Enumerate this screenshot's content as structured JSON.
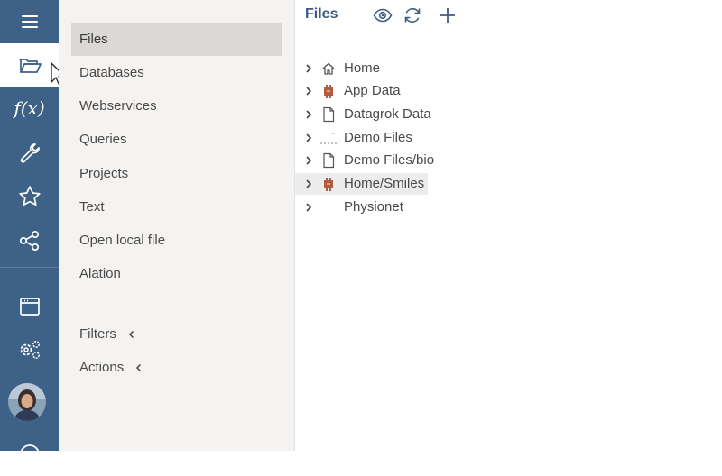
{
  "app": {
    "colors": {
      "rail": "#3e6187",
      "panel": "#f5f3f1",
      "selected": "#dbd9d6",
      "title": "#3e5c80",
      "connector_icon": "#b55a3c"
    }
  },
  "rail": {
    "items": [
      {
        "icon": "hamburger-menu-icon"
      },
      {
        "icon": "folder-open-icon",
        "active": true
      },
      {
        "icon": "function-icon",
        "label": "f(x)"
      },
      {
        "icon": "wrench-icon"
      },
      {
        "icon": "star-icon"
      },
      {
        "icon": "share-icon"
      },
      {
        "icon": "window-icon"
      },
      {
        "icon": "settings-gears-icon"
      },
      {
        "icon": "user-avatar"
      },
      {
        "icon": "help-icon"
      }
    ]
  },
  "sidebar": {
    "items": [
      {
        "label": "Files",
        "selected": true
      },
      {
        "label": "Databases"
      },
      {
        "label": "Webservices"
      },
      {
        "label": "Queries"
      },
      {
        "label": "Projects"
      },
      {
        "label": "Text"
      },
      {
        "label": "Open local file"
      },
      {
        "label": "Alation"
      }
    ],
    "sections": [
      {
        "label": "Filters",
        "icon": "chevron-left-icon"
      },
      {
        "label": "Actions",
        "icon": "chevron-left-icon"
      }
    ]
  },
  "main": {
    "title": "Files",
    "toolbar": [
      {
        "icon": "eye-icon"
      },
      {
        "icon": "refresh-icon"
      },
      {
        "icon": "plus-icon"
      }
    ],
    "tree": [
      {
        "label": "Home",
        "icon": "home-icon"
      },
      {
        "label": "App Data",
        "icon": "connector-icon"
      },
      {
        "label": "Datagrok Data",
        "icon": "file-icon"
      },
      {
        "label": "Demo Files",
        "icon": "dotted-icon"
      },
      {
        "label": "Demo Files/bio",
        "icon": "file-icon"
      },
      {
        "label": "Home/Smiles",
        "icon": "connector-icon",
        "highlighted": true
      },
      {
        "label": "Physionet",
        "icon": "none"
      }
    ]
  }
}
